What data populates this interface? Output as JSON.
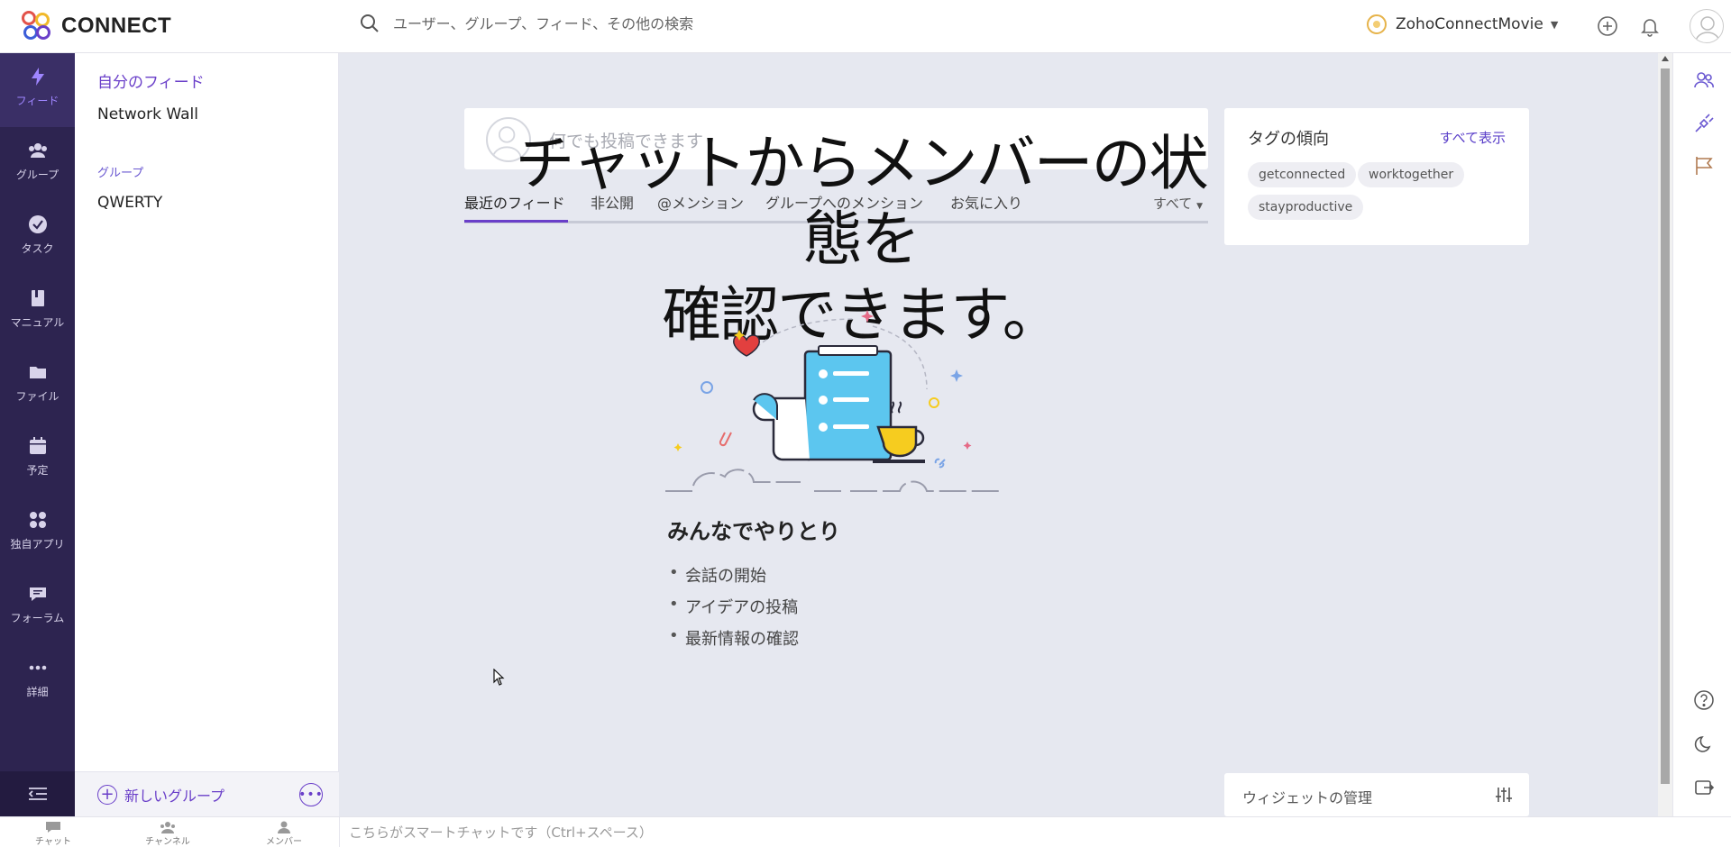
{
  "app": {
    "logo_text": "CONNECT",
    "search_placeholder": "ユーザー、グループ、フィード、その他の検索",
    "network_name": "ZohoConnectMovie"
  },
  "rail": {
    "items": [
      {
        "label": "フィード",
        "icon": "lightning-icon",
        "active": true
      },
      {
        "label": "グループ",
        "icon": "group-icon"
      },
      {
        "label": "タスク",
        "icon": "check-circle-icon"
      },
      {
        "label": "マニュアル",
        "icon": "manual-icon"
      },
      {
        "label": "ファイル",
        "icon": "folder-icon"
      },
      {
        "label": "予定",
        "icon": "calendar-icon"
      },
      {
        "label": "独自アプリ",
        "icon": "apps-icon"
      },
      {
        "label": "フォーラム",
        "icon": "forum-icon"
      },
      {
        "label": "詳細",
        "icon": "more-icon"
      }
    ]
  },
  "sidebar": {
    "my_feed": "自分のフィード",
    "network_wall": "Network Wall",
    "groups_heading": "グループ",
    "group_item": "QWERTY",
    "new_group": "新しいグループ"
  },
  "composer": {
    "placeholder": "何でも投稿できます"
  },
  "tabs": {
    "items": [
      "最近のフィード",
      "非公開",
      "@メンション",
      "グループへのメンション",
      "お気に入り"
    ],
    "filter": "すべて"
  },
  "overlay_caption": {
    "line1": "チャットからメンバーの状態を",
    "line2": "確認できます。"
  },
  "empty_state": {
    "title": "みんなでやりとり",
    "bullets": [
      "会話の開始",
      "アイデアの投稿",
      "最新情報の確認"
    ]
  },
  "tags_widget": {
    "title": "タグの傾向",
    "view_all": "すべて表示",
    "tags": [
      "getconnected",
      "worktogether",
      "stayproductive"
    ]
  },
  "widget_manage": {
    "label": "ウィジェットの管理"
  },
  "bottombar": {
    "chat": "チャット",
    "channel": "チャンネル",
    "member": "メンバー",
    "smartchat_placeholder": "こちらがスマートチャットです（Ctrl+スペース）"
  },
  "colors": {
    "accent": "#6a3fc9",
    "rail_bg": "#2d2450",
    "page_bg": "#e6e8f0"
  }
}
